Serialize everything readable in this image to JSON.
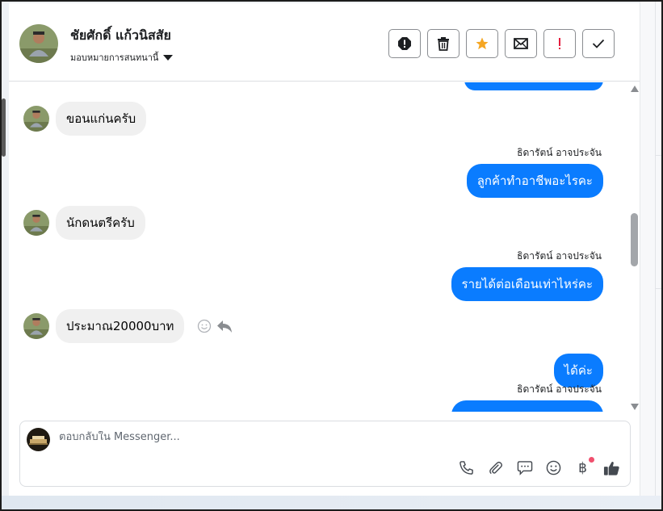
{
  "header": {
    "contact_name": "ชัยศักดิ์ แก้วนิสสัย",
    "assign_label": "มอบหมายการสนทนานี้"
  },
  "actions": [
    {
      "name": "report-button",
      "icon": "alert-octagon-icon"
    },
    {
      "name": "delete-button",
      "icon": "trash-icon"
    },
    {
      "name": "star-button",
      "icon": "star-icon",
      "color": "#f5a623"
    },
    {
      "name": "mark-unread-button",
      "icon": "mail-icon"
    },
    {
      "name": "mark-important-button",
      "icon": "exclamation-icon",
      "color": "#e41e3f"
    },
    {
      "name": "mark-done-button",
      "icon": "check-icon"
    }
  ],
  "messages": [
    {
      "direction": "out",
      "text": ""
    },
    {
      "direction": "in",
      "text": "ขอนแก่นครับ"
    },
    {
      "direction": "out",
      "sender": "ธิดารัตน์ อาจประจัน",
      "text": "ลูกค้าทำอาชีพอะไรคะ"
    },
    {
      "direction": "in",
      "text": "นักดนตรีครับ"
    },
    {
      "direction": "out",
      "sender": "ธิดารัตน์ อาจประจัน",
      "text": "รายได้ต่อเดือนเท่าไหร่คะ"
    },
    {
      "direction": "in",
      "text": "ประมาณ20000บาท"
    },
    {
      "direction": "out",
      "text": "ได้ค่ะ"
    },
    {
      "direction": "out",
      "sender": "ธิดารัตน์ อาจประจัน",
      "text": ""
    }
  ],
  "composer": {
    "placeholder": "ตอบกลับใน Messenger...",
    "value": ""
  },
  "tools": [
    "phone-icon",
    "paperclip-icon",
    "chat-bubble-icon",
    "emoji-icon",
    "baht-icon",
    "thumbs-up-icon"
  ],
  "colors": {
    "outgoing_bubble": "#0a7cff",
    "incoming_bubble": "#f0f0f0",
    "notification_dot": "#f0506e"
  }
}
